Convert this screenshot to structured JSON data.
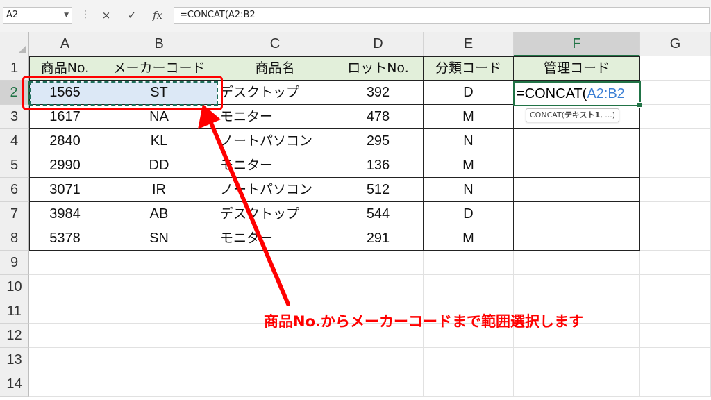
{
  "formula_bar": {
    "name_box": "A2",
    "cancel_icon": "×",
    "enter_icon": "✓",
    "fx_label": "fx",
    "formula": "=CONCAT(A2:B2"
  },
  "columns": [
    "A",
    "B",
    "C",
    "D",
    "E",
    "F",
    "G"
  ],
  "rows": [
    "1",
    "2",
    "3",
    "4",
    "5",
    "6",
    "7",
    "8",
    "9",
    "10",
    "11",
    "12",
    "13",
    "14"
  ],
  "table": {
    "headers": [
      "商品No.",
      "メーカーコード",
      "商品名",
      "ロットNo.",
      "分類コード",
      "管理コード"
    ],
    "rows": [
      [
        "1565",
        "ST",
        "デスクトップ",
        "392",
        "D"
      ],
      [
        "1617",
        "NA",
        "モニター",
        "478",
        "M"
      ],
      [
        "2840",
        "KL",
        "ノートパソコン",
        "295",
        "N"
      ],
      [
        "2990",
        "DD",
        "モニター",
        "136",
        "M"
      ],
      [
        "3071",
        "IR",
        "ノートパソコン",
        "512",
        "N"
      ],
      [
        "3984",
        "AB",
        "デスクトップ",
        "544",
        "D"
      ],
      [
        "5378",
        "SN",
        "モニター",
        "291",
        "M"
      ]
    ]
  },
  "active_cell": {
    "prefix": "=CONCAT(",
    "ref": "A2:B2"
  },
  "tooltip": {
    "fn": "CONCAT(",
    "arg": "テキスト1",
    "rest": ", ...)"
  },
  "annotation": {
    "text": "商品No.からメーカーコードまで範囲選択します",
    "color": "#ff0000"
  },
  "colors": {
    "header_fill": "#e2efda",
    "excel_green": "#217346",
    "selection_fill": "#dce8f6",
    "reference_blue": "#3b7fd4"
  }
}
